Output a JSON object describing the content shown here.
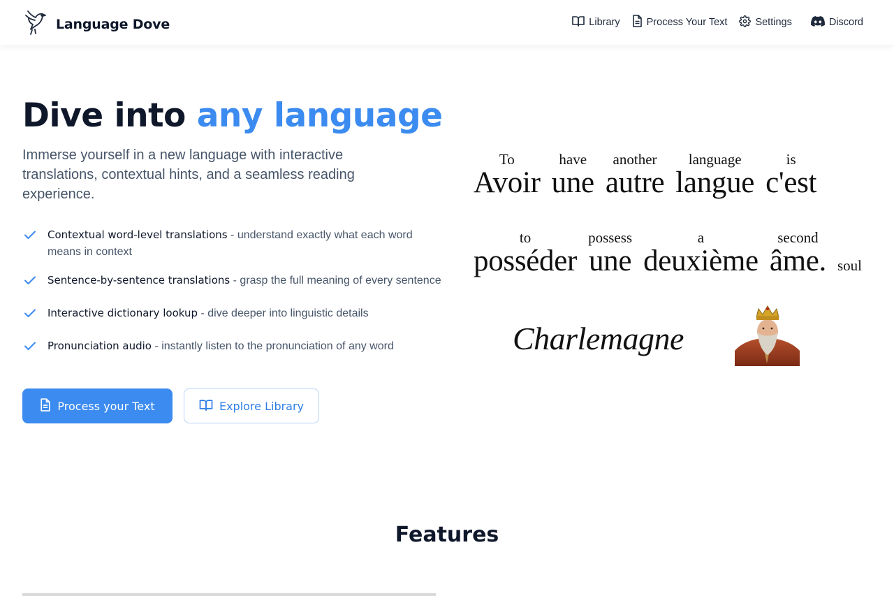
{
  "brand": {
    "name": "Language Dove",
    "logo_icon": "dove-icon"
  },
  "nav": [
    {
      "label": "Library",
      "icon": "book-icon"
    },
    {
      "label": "Process Your Text",
      "icon": "document-icon"
    },
    {
      "label": "Settings",
      "icon": "gear-icon"
    },
    {
      "label": "Discord",
      "icon": "discord-icon"
    }
  ],
  "hero": {
    "title_start": "Dive into ",
    "title_accent": "any language",
    "subtitle": "Immerse yourself in a new language with interactive translations, contextual hints, and a seamless reading experience.",
    "features": [
      {
        "title": "Contextual word-level translations",
        "desc": " - understand exactly what each word means in context"
      },
      {
        "title": "Sentence-by-sentence translations",
        "desc": " - grasp the full meaning of every sentence"
      },
      {
        "title": "Interactive dictionary lookup",
        "desc": " - dive deeper into linguistic details"
      },
      {
        "title": "Pronunciation audio",
        "desc": " - instantly listen to the pronunciation of any word"
      }
    ],
    "primary_button": "Process your Text",
    "secondary_button": "Explore Library"
  },
  "illustration": {
    "line1": [
      {
        "en": "To",
        "fr": "Avoir"
      },
      {
        "en": "have",
        "fr": "une"
      },
      {
        "en": "another",
        "fr": "autre"
      },
      {
        "en": "language",
        "fr": "langue"
      },
      {
        "en": "is",
        "fr": "c'est"
      }
    ],
    "line2": [
      {
        "en": "to",
        "fr": "posséder"
      },
      {
        "en": "possess",
        "fr": "une"
      },
      {
        "en": "a",
        "fr": "deuxième"
      },
      {
        "en": "second",
        "fr": "âme."
      },
      {
        "en": "soul",
        "fr": ""
      }
    ],
    "signature": "Charlemagne"
  },
  "features_section": {
    "title": "Features"
  },
  "colors": {
    "accent": "#3b8bf0",
    "text": "#0f172a",
    "muted": "#475569",
    "check": "#3b8bf0"
  }
}
